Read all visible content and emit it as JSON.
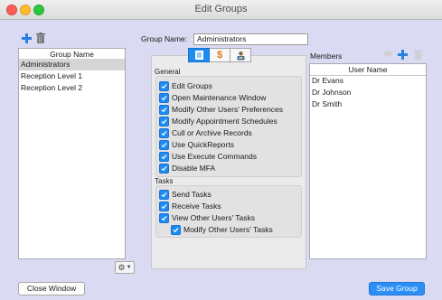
{
  "window": {
    "title": "Edit Groups"
  },
  "groups_panel": {
    "header": "Group Name",
    "items": [
      "Administrators",
      "Reception Level 1",
      "Reception Level 2"
    ],
    "selected_index": 0
  },
  "group_name": {
    "label": "Group Name:",
    "value": "Administrators"
  },
  "tabs": [
    {
      "icon": "list-icon",
      "active": true
    },
    {
      "icon": "dollar-icon",
      "active": false
    },
    {
      "icon": "user-badge-icon",
      "active": false
    }
  ],
  "general": {
    "title": "General",
    "items": [
      "Edit Groups",
      "Open Maintenance Window",
      "Modify Other Users' Preferences",
      "Modify Appointment Schedules",
      "Cull or Archive Records",
      "Use QuickReports",
      "Use Execute Commands",
      "Disable MFA"
    ]
  },
  "tasks": {
    "title": "Tasks",
    "items": [
      "Send Tasks",
      "Receive Tasks",
      "View Other Users' Tasks"
    ],
    "sub_item": "Modify Other Users' Tasks"
  },
  "members": {
    "label": "Members",
    "header": "User Name",
    "items": [
      "Dr Evans",
      "Dr Johnson",
      "Dr Smith"
    ]
  },
  "buttons": {
    "close": "Close Window",
    "save": "Save Group"
  },
  "colors": {
    "accent": "#1f8bf0",
    "window_bg": "#dadaf2"
  }
}
